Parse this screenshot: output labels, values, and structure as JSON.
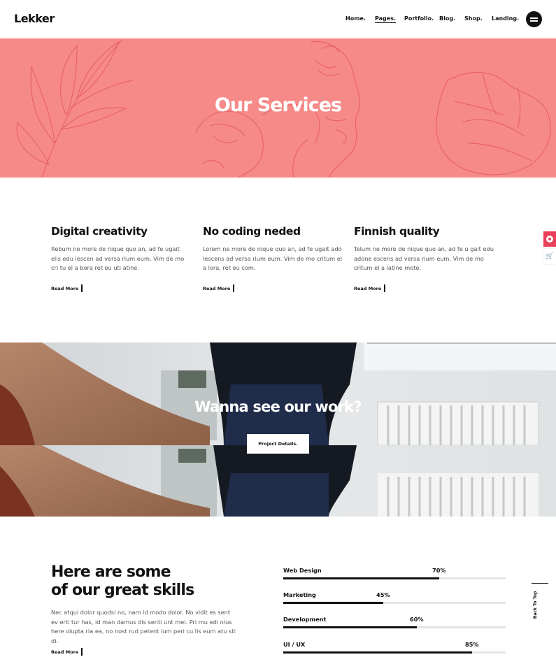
{
  "header": {
    "logo": "Lekker",
    "nav": [
      "Home.",
      "Pages.",
      "Portfolio.",
      "Blog.",
      "Shop.",
      "Landing."
    ],
    "active_nav": "Pages."
  },
  "hero": {
    "title": "Our Services",
    "bg_color": "#f68a88"
  },
  "services": [
    {
      "title": "Digital creativity",
      "text": "Rebum ne more de nique quo an, ad fe ugait elis edu lescen ad versa rium eum. Vim de mo cri tu el a bora ret eu uti atine.",
      "link": "Read More"
    },
    {
      "title": "No coding neded",
      "text": "Lorem ne more de nique quo an, ad fe ugait ado lescens ad versa rium eum. Vim de mo critum el a lora, ret eu com.",
      "link": "Read More"
    },
    {
      "title": "Finnish quality",
      "text": "Telum ne more de nique quo an, ad fe u gait edu adone escens ad versa rium eum. Vim de mo critum el a latine mote.",
      "link": "Read More"
    }
  ],
  "side_widgets": {
    "icons": [
      "lifebuoy-icon",
      "cart-icon"
    ],
    "accent": "#e8405a",
    "cart_glyph": "🛒"
  },
  "work": {
    "title": "Wanna see our work?",
    "button": "Project Details."
  },
  "skills": {
    "title_line1": "Here are some",
    "title_line2": "of our great skills",
    "text": "Nec atqui dolor quodsi no, nam id modo dolor. No vidit es sent ev erti tur has, id man damus dis senti unt mei. Pri mu edi nius here olupta ria ea, no nost rud petent ium peri cu lis eum atu sit di.",
    "link": "Read More",
    "items": [
      {
        "name": "Web Design",
        "percent": 70,
        "label": "70%"
      },
      {
        "name": "Marketing",
        "percent": 45,
        "label": "45%"
      },
      {
        "name": "Development",
        "percent": 60,
        "label": "60%"
      },
      {
        "name": "UI / UX",
        "percent": 85,
        "label": "85%"
      }
    ]
  },
  "back_to_top": "Back To Top"
}
